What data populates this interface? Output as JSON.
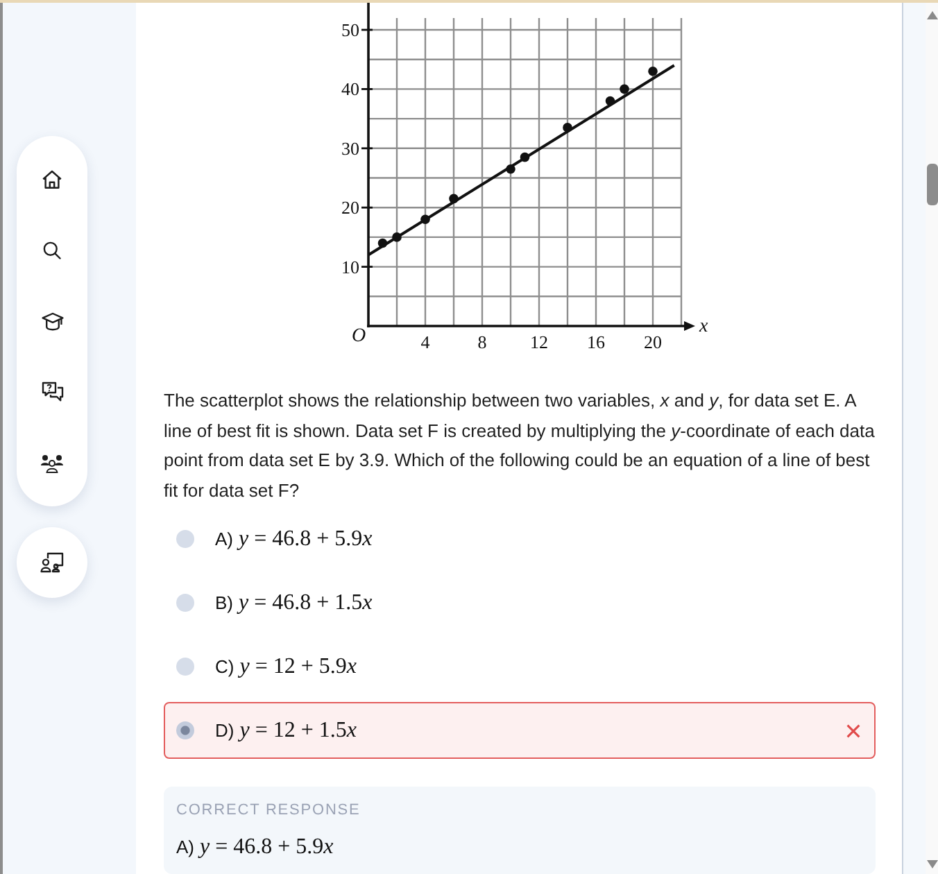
{
  "question": {
    "chart_data": {
      "type": "scatter",
      "xlabel": "x",
      "x": [
        1,
        2,
        4,
        6,
        10,
        11,
        14,
        17,
        18,
        20
      ],
      "series": [
        {
          "type": "scatter",
          "values": [
            14,
            15,
            18,
            21.5,
            26.5,
            28.5,
            33.5,
            38,
            40,
            43
          ]
        },
        {
          "type": "line",
          "x": [
            0,
            21.5
          ],
          "values": [
            12,
            44
          ]
        }
      ],
      "xlim": [
        0,
        22
      ],
      "ylim": [
        0,
        52
      ],
      "xticks": [
        {
          "value": 0,
          "label": "O"
        },
        4,
        8,
        12,
        16,
        20
      ],
      "yticks": [
        10,
        20,
        30,
        40,
        50
      ],
      "grid": true
    },
    "text": "The scatterplot shows the relationship between two variables, *x* and *y*, for data set E. A line of best fit is shown. Data set F is created by multiplying the *y*-coordinate of each data point from data set E by 3.9. Which of the following could be an equation of a line of best fit for data set F?"
  },
  "options": [
    {
      "letter": "A)",
      "equation": "y = 46.8 + 5.9x",
      "selected": false,
      "incorrect": false
    },
    {
      "letter": "B)",
      "equation": "y = 46.8 + 1.5x",
      "selected": false,
      "incorrect": false
    },
    {
      "letter": "C)",
      "equation": "y = 12 + 5.9x",
      "selected": false,
      "incorrect": false
    },
    {
      "letter": "D)",
      "equation": "y = 12 + 1.5x",
      "selected": true,
      "incorrect": true
    }
  ],
  "correct_response": {
    "heading": "CORRECT RESPONSE",
    "letter": "A)",
    "equation": "y = 46.8 + 5.9x"
  }
}
